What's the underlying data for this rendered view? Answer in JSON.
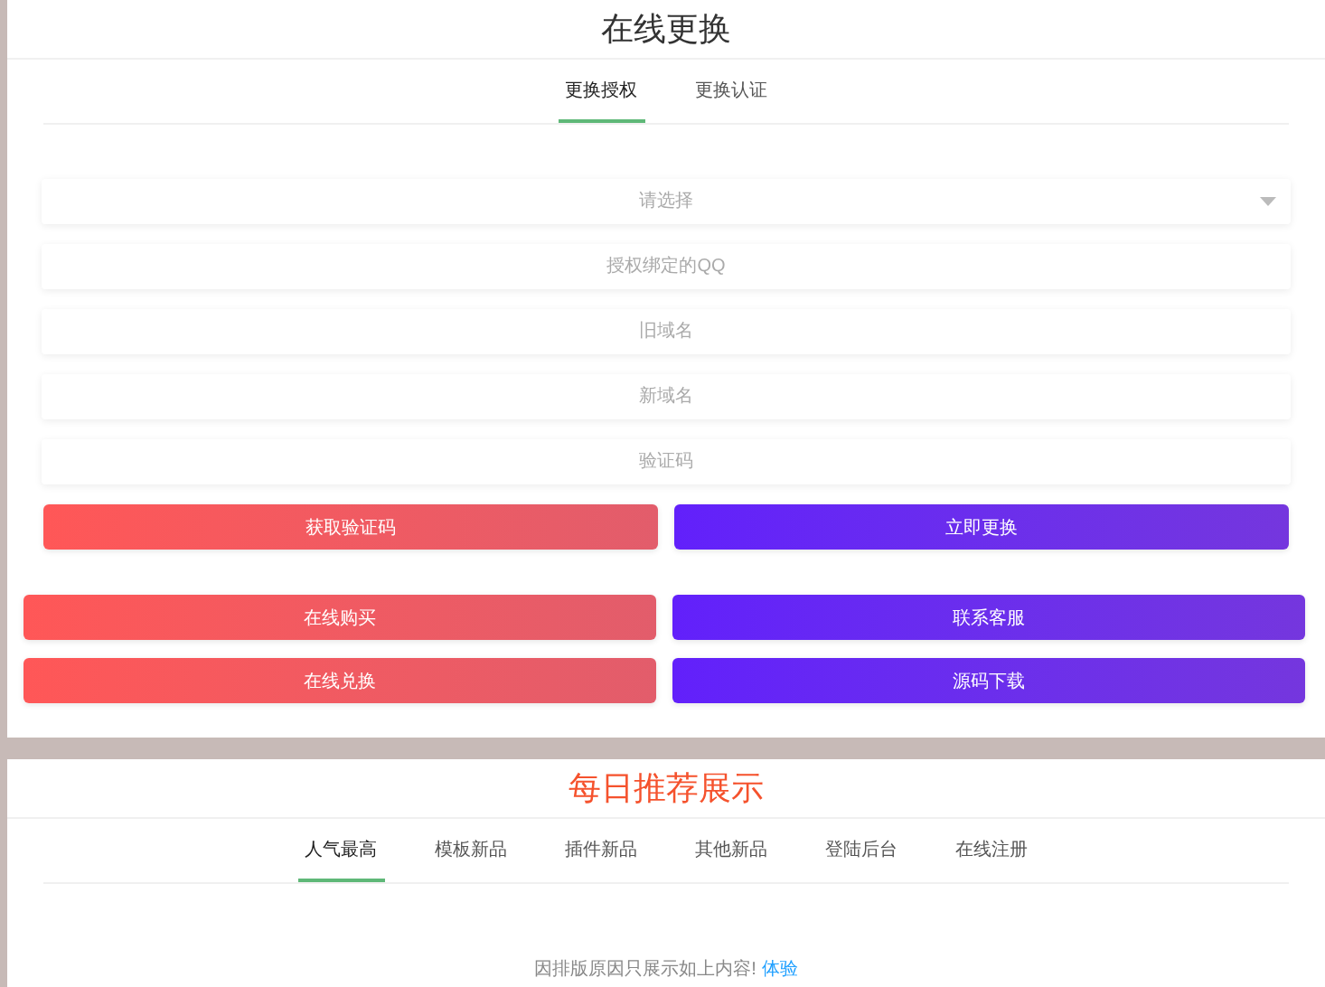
{
  "exchange": {
    "title": "在线更换",
    "tabs": [
      {
        "label": "更换授权",
        "selected": true
      },
      {
        "label": "更换认证",
        "selected": false
      }
    ],
    "fields": [
      {
        "kind": "select",
        "placeholder": "请选择"
      },
      {
        "kind": "input",
        "placeholder": "授权绑定的QQ"
      },
      {
        "kind": "input",
        "placeholder": "旧域名"
      },
      {
        "kind": "input",
        "placeholder": "新域名"
      },
      {
        "kind": "input",
        "placeholder": "验证码"
      }
    ],
    "form_buttons": [
      {
        "label": "获取验证码",
        "color": "#ff5757"
      },
      {
        "label": "立即更换",
        "color": "#6220fb"
      }
    ],
    "buttons": [
      {
        "label": "在线购买",
        "color": "#ff5757"
      },
      {
        "label": "联系客服",
        "color": "#6220fb"
      },
      {
        "label": "在线兑换",
        "color": "#ff5757"
      },
      {
        "label": "源码下载",
        "color": "#6220fb"
      }
    ]
  },
  "daily": {
    "title": "每日推荐展示",
    "tabs": [
      {
        "label": "人气最高",
        "selected": true
      },
      {
        "label": "模板新品",
        "selected": false
      },
      {
        "label": "插件新品",
        "selected": false
      },
      {
        "label": "其他新品",
        "selected": false
      },
      {
        "label": "登陆后台",
        "selected": false
      },
      {
        "label": "在线注册",
        "selected": false
      }
    ],
    "notice": {
      "text": "因排版原因只展示如上内容!",
      "link": "体验"
    }
  }
}
